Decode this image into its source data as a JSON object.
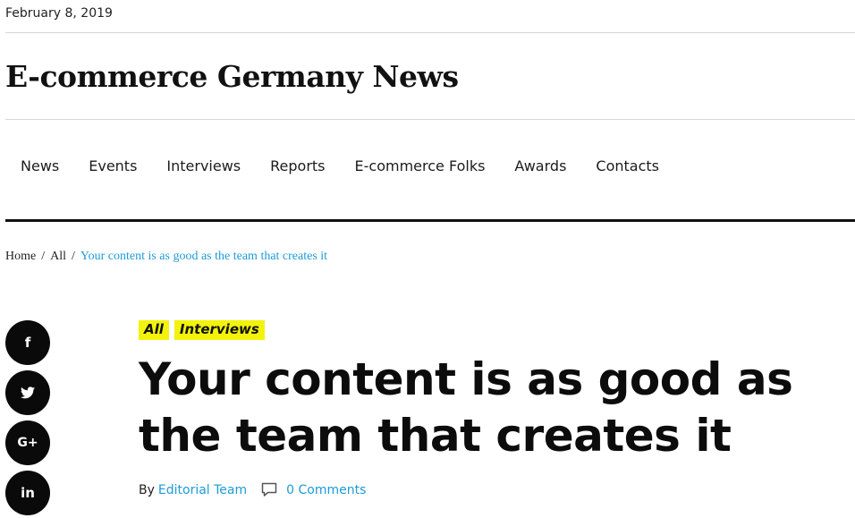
{
  "date": "February 8, 2019",
  "site_title": "E-commerce Germany News",
  "nav": [
    "News",
    "Events",
    "Interviews",
    "Reports",
    "E-commerce Folks",
    "Awards",
    "Contacts"
  ],
  "breadcrumb": {
    "home": "Home",
    "section": "All",
    "separator": "/",
    "current": "Your content is as good as the team that creates it"
  },
  "share": {
    "facebook_icon": "f",
    "twitter_icon": "twitter-bird",
    "googleplus_icon": "G+",
    "linkedin_icon": "in"
  },
  "article": {
    "tags": [
      "All",
      "Interviews"
    ],
    "title": "Your content is as good as the team that creates it",
    "by_label": "By",
    "author": "Editorial Team",
    "comments": "0 Comments"
  },
  "colors": {
    "accent_link": "#1e9bd7",
    "tag_bg": "#f2f20c",
    "text": "#111111"
  }
}
